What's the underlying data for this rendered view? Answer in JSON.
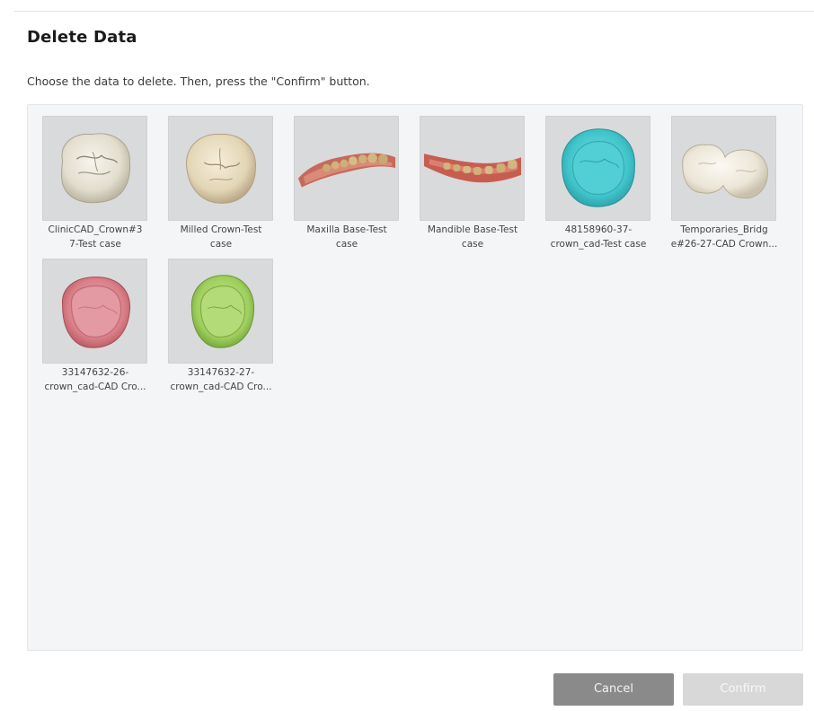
{
  "dialog": {
    "title": "Delete Data",
    "instruction": "Choose the data to delete. Then, press the \"Confirm\" button."
  },
  "items": [
    {
      "caption": "ClinicCAD_Crown#3\n7-Test case",
      "thumbnail": "crown-ivory-icon",
      "color": "#e8e4d8"
    },
    {
      "caption": "Milled Crown-Test\ncase",
      "thumbnail": "crown-beige-icon",
      "color": "#e7dcc4"
    },
    {
      "caption": "Maxilla Base-Test\ncase",
      "thumbnail": "maxilla-scan-icon",
      "color": "#c9756a"
    },
    {
      "caption": "Mandible Base-Test\ncase",
      "thumbnail": "mandible-scan-icon",
      "color": "#c4665a"
    },
    {
      "caption": "48158960-37-\ncrown_cad-Test case",
      "thumbnail": "crown-cyan-icon",
      "color": "#4fd3d8"
    },
    {
      "caption": "Temporaries_Bridg\ne#26-27-CAD Crown...",
      "thumbnail": "bridge-ivory-icon",
      "color": "#efebe0"
    },
    {
      "caption": "33147632-26-\ncrown_cad-CAD Cro...",
      "thumbnail": "crown-pink-icon",
      "color": "#dc8a92"
    },
    {
      "caption": "33147632-27-\ncrown_cad-CAD Cro...",
      "thumbnail": "crown-green-icon",
      "color": "#9fcf5e"
    }
  ],
  "buttons": {
    "cancel": "Cancel",
    "confirm": "Confirm"
  }
}
